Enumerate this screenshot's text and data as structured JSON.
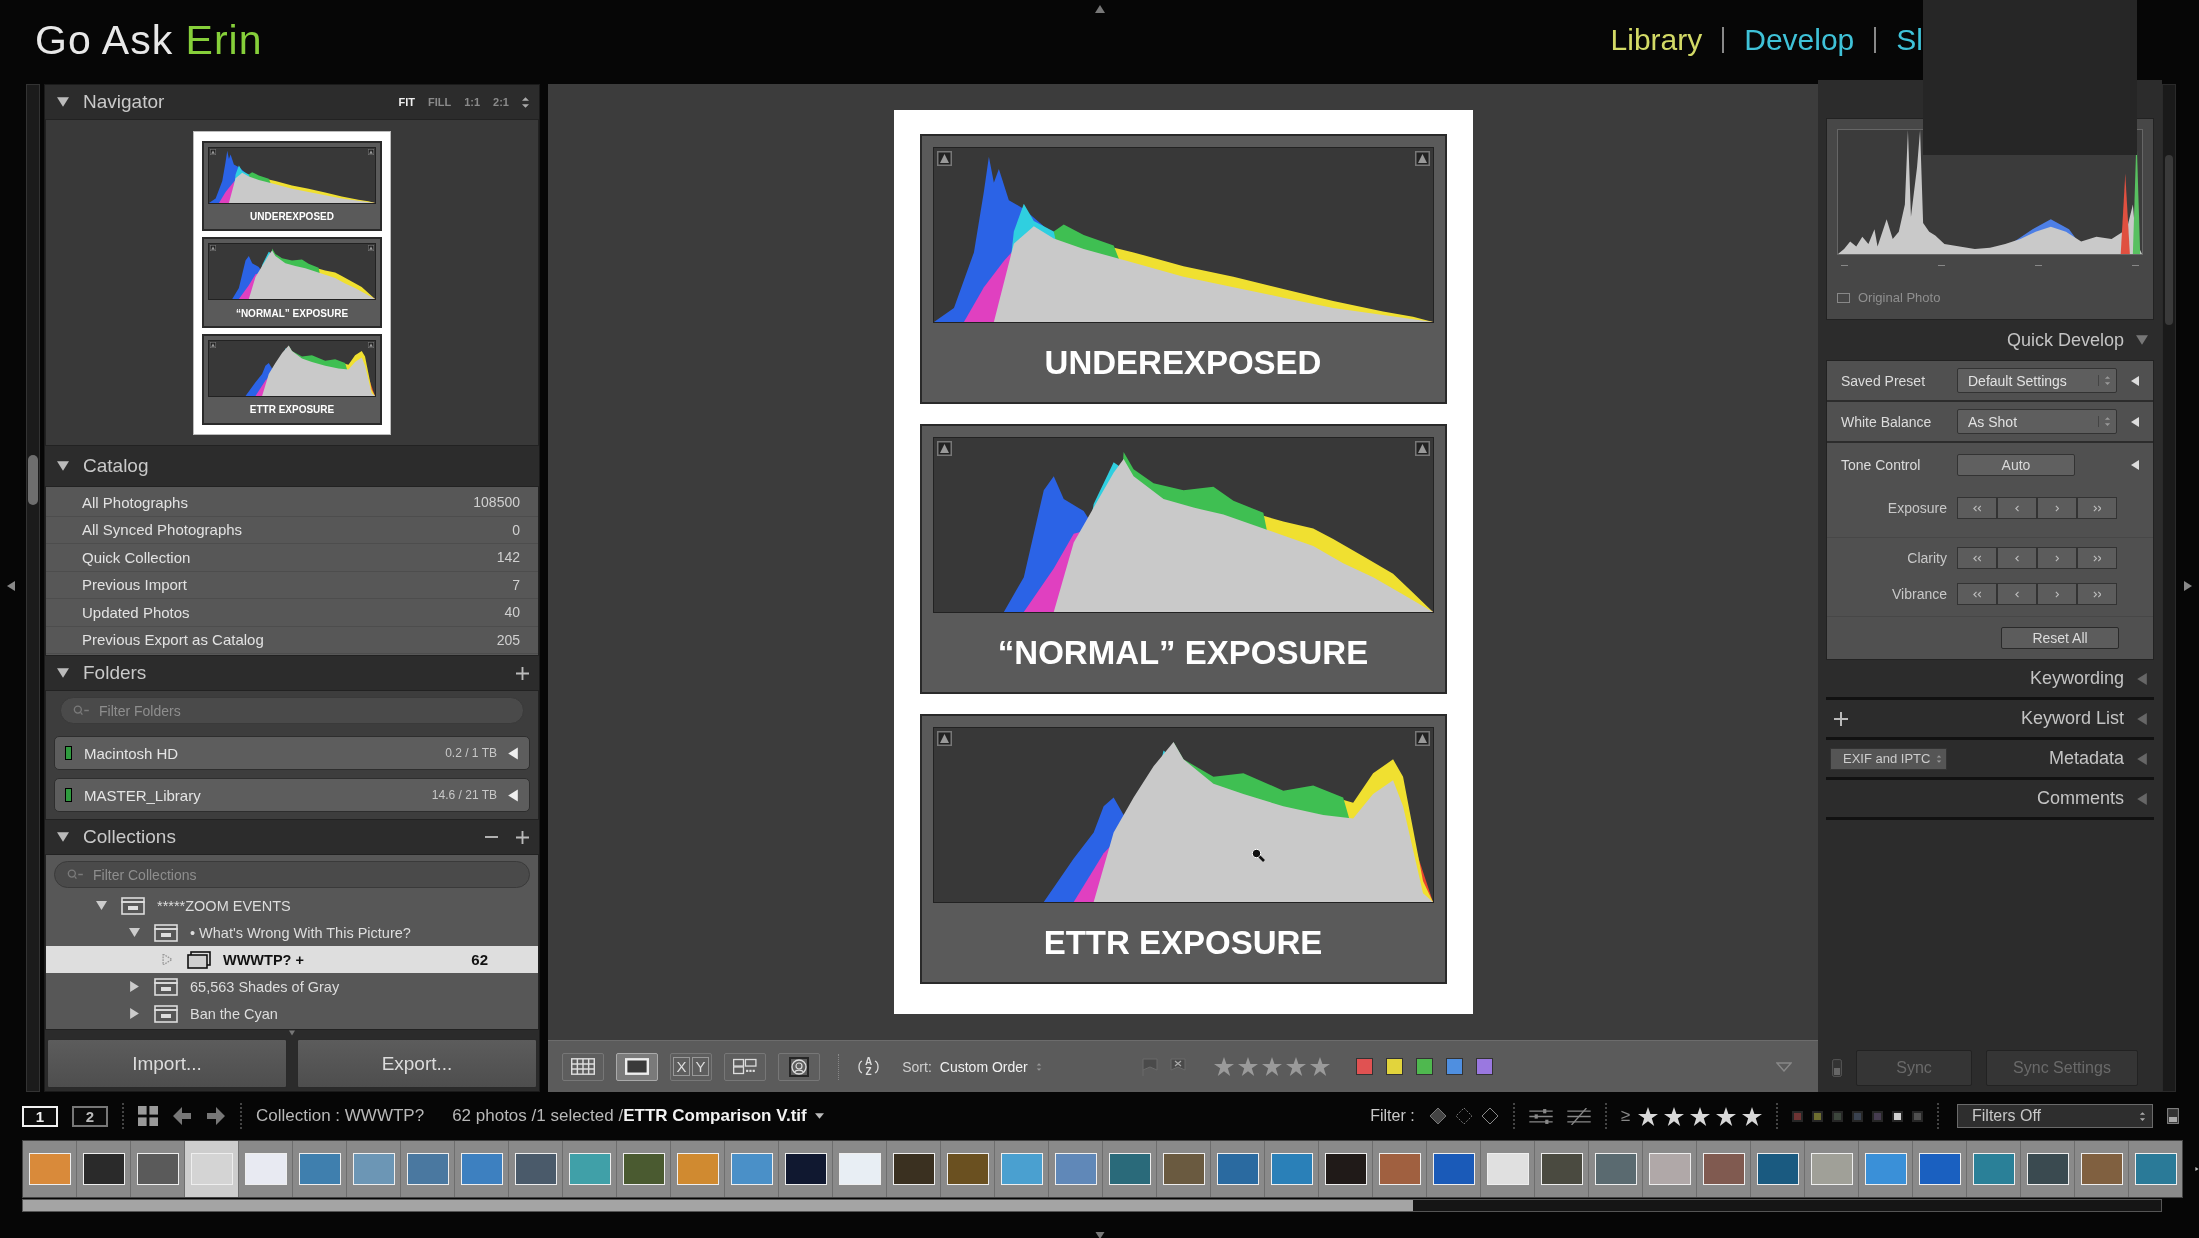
{
  "header": {
    "brand": {
      "name": "Go Ask",
      "accent": "Erin"
    },
    "modules": [
      {
        "label": "Library",
        "selected": true
      },
      {
        "label": "Develop",
        "selected": false
      },
      {
        "label": "Sl",
        "selected": false
      }
    ]
  },
  "left_panel": {
    "navigator": {
      "title": "Navigator",
      "expanded": true,
      "zoom_options": [
        {
          "label": "FIT",
          "selected": true
        },
        {
          "label": "FILL",
          "selected": false
        },
        {
          "label": "1:1",
          "selected": false
        },
        {
          "label": "2:1",
          "selected": false
        }
      ],
      "preview_panels": [
        {
          "kind": "under",
          "label": "UNDEREXPOSED"
        },
        {
          "kind": "normal",
          "label": "“NORMAL” EXPOSURE"
        },
        {
          "kind": "ettr",
          "label": "ETTR EXPOSURE"
        }
      ]
    },
    "catalog": {
      "title": "Catalog",
      "expanded": true,
      "items": [
        {
          "name": "All Photographs",
          "count": "108500",
          "selected": false
        },
        {
          "name": "All Synced Photographs",
          "count": "0",
          "selected": false
        },
        {
          "name": "Quick Collection",
          "count": "142",
          "selected": false
        },
        {
          "name": "Previous Import",
          "count": "7",
          "selected": false
        },
        {
          "name": "Updated Photos",
          "count": "40",
          "selected": false
        },
        {
          "name": "Previous Export as Catalog",
          "count": "205",
          "selected": false
        }
      ]
    },
    "folders": {
      "title": "Folders",
      "expanded": true,
      "filter_placeholder": "Filter Folders",
      "volumes": [
        {
          "name": "Macintosh HD",
          "usage": "0.2 / 1 TB",
          "color": "#2f9a3e",
          "expanded": false
        },
        {
          "name": "MASTER_Library",
          "usage": "14.6 / 21 TB",
          "color": "#2f9a3e",
          "expanded": false
        }
      ]
    },
    "collections": {
      "title": "Collections",
      "expanded": true,
      "filter_placeholder": "Filter Collections",
      "tree": [
        {
          "kind": "set",
          "name": "*****ZOOM EVENTS",
          "expanded": true,
          "selected": false,
          "children": [
            {
              "kind": "set",
              "name": "• What's Wrong With This Picture?",
              "expanded": true,
              "selected": false,
              "children": [
                {
                  "kind": "collection",
                  "name": "WWWTP? +",
                  "count": "62",
                  "selected": true
                }
              ]
            },
            {
              "kind": "set",
              "name": "65,563 Shades of Gray",
              "expanded": false,
              "selected": false
            },
            {
              "kind": "set",
              "name": "Ban the Cyan",
              "expanded": false,
              "selected": false
            }
          ]
        }
      ]
    },
    "buttons": [
      "Import...",
      "Export..."
    ]
  },
  "viewer": {
    "panels": [
      {
        "kind": "under",
        "label": "UNDEREXPOSED"
      },
      {
        "kind": "normal",
        "label": "“NORMAL” EXPOSURE"
      },
      {
        "kind": "ettr",
        "label": "ETTR EXPOSURE"
      }
    ],
    "toolbar": {
      "view_modes": [
        {
          "kind": "grid",
          "selected": false
        },
        {
          "kind": "loupe",
          "selected": true
        },
        {
          "kind": "compare",
          "selected": false,
          "letters": [
            "X",
            "Y"
          ]
        },
        {
          "kind": "survey",
          "selected": false
        },
        {
          "kind": "people",
          "selected": false
        }
      ],
      "sort": {
        "letters": [
          "A",
          "Z"
        ],
        "label": "Sort:",
        "value": "Custom Order"
      },
      "stars": 0,
      "color_labels": [
        {
          "color": "#e05252"
        },
        {
          "color": "#e2d43c"
        },
        {
          "color": "#4fb84f"
        },
        {
          "color": "#4f8fe0"
        },
        {
          "color": "#9a78e0"
        }
      ]
    }
  },
  "right_panel": {
    "original_photo": {
      "label": "Original Photo",
      "checked": false
    },
    "quick_develop": {
      "title": "Quick Develop",
      "expanded": true,
      "rows": [
        {
          "kind": "select",
          "label": "Saved Preset",
          "value": "Default Settings"
        },
        {
          "kind": "select",
          "label": "White Balance",
          "value": "As Shot"
        },
        {
          "kind": "button",
          "label": "Tone Control",
          "value": "Auto"
        },
        {
          "kind": "stepper",
          "label": "Exposure"
        },
        {
          "kind": "stepper",
          "label": "Clarity"
        },
        {
          "kind": "stepper",
          "label": "Vibrance"
        },
        {
          "kind": "reset",
          "value": "Reset All"
        }
      ]
    },
    "sections": [
      {
        "title": "Keywording",
        "expanded": false
      },
      {
        "title": "Keyword List",
        "expanded": false
      },
      {
        "title": "Metadata",
        "expanded": false,
        "preset": "EXIF and IPTC"
      },
      {
        "title": "Comments",
        "expanded": false
      }
    ],
    "sync_buttons": [
      {
        "label": "Sync",
        "disabled": true
      },
      {
        "label": "Sync Settings",
        "disabled": true
      }
    ]
  },
  "filmstrip": {
    "screens": [
      {
        "label": "1",
        "selected": true
      },
      {
        "label": "2",
        "selected": false
      }
    ],
    "source": "Collection : WWWTP?",
    "status": "62 photos /1 selected /**ETTR Comparison V.tif**",
    "filter": {
      "label": "Filter :",
      "rating_operator": "≥",
      "stars": 5,
      "label_colors": [
        {
          "color": "#6e3434"
        },
        {
          "color": "#6e6e30"
        },
        {
          "color": "#3c463c"
        },
        {
          "color": "#3a4250"
        },
        {
          "color": "#463c50"
        },
        {
          "color": "#d0d0d0"
        },
        {
          "color": "#505050"
        }
      ],
      "preset": "Filters Off"
    },
    "thumbnails": [
      {
        "color": "#d98a3a",
        "selected": false
      },
      {
        "color": "#2a2a2a",
        "selected": false
      },
      {
        "color": "#5a5a5a",
        "selected": false
      },
      {
        "color": "#d4d4d4",
        "selected": true
      },
      {
        "color": "#e8eaf2",
        "selected": false
      },
      {
        "color": "#3f7fae",
        "selected": false
      },
      {
        "color": "#6c96b5",
        "selected": false
      },
      {
        "color": "#4a78a0",
        "selected": false
      },
      {
        "color": "#3d80c0",
        "selected": false
      },
      {
        "color": "#4a5a6a",
        "selected": false
      },
      {
        "color": "#40a0a8",
        "selected": false
      },
      {
        "color": "#4a5a30",
        "selected": false
      },
      {
        "color": "#d08a30",
        "selected": false
      },
      {
        "color": "#4a90c8",
        "selected": false
      },
      {
        "color": "#101830",
        "selected": false
      },
      {
        "color": "#e8eef4",
        "selected": false
      },
      {
        "color": "#3a3020",
        "selected": false
      },
      {
        "color": "#6a5020",
        "selected": false
      },
      {
        "color": "#4aa0d0",
        "selected": false
      },
      {
        "color": "#6088b8",
        "selected": false
      },
      {
        "color": "#2a6a7a",
        "selected": false
      },
      {
        "color": "#6a5a40",
        "selected": false
      },
      {
        "color": "#2a6aa0",
        "selected": false
      },
      {
        "color": "#2a80b8",
        "selected": false
      },
      {
        "color": "#201a18",
        "selected": false
      },
      {
        "color": "#a06040",
        "selected": false
      },
      {
        "color": "#1a5ab8",
        "selected": false
      },
      {
        "color": "#e0e0e0",
        "selected": false
      },
      {
        "color": "#4a4a40",
        "selected": false
      },
      {
        "color": "#5a6a70",
        "selected": false
      },
      {
        "color": "#b0a8a8",
        "selected": false
      },
      {
        "color": "#805a50",
        "selected": false
      },
      {
        "color": "#1a5a80",
        "selected": false
      },
      {
        "color": "#a0a098",
        "selected": false
      },
      {
        "color": "#3a90d8",
        "selected": false
      },
      {
        "color": "#1a60c0",
        "selected": false
      },
      {
        "color": "#2a8098",
        "selected": false
      },
      {
        "color": "#3a4a50",
        "selected": false
      },
      {
        "color": "#806040",
        "selected": false
      },
      {
        "color": "#2a7a98",
        "selected": false
      }
    ]
  }
}
